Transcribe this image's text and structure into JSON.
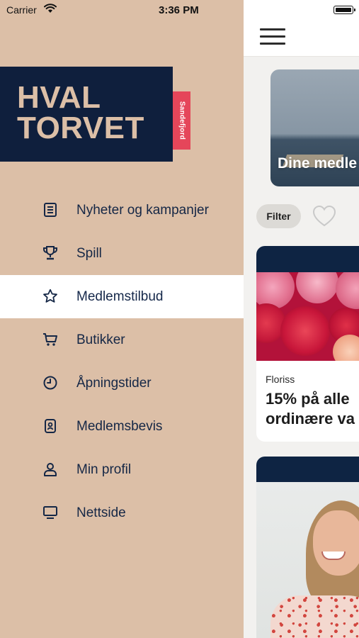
{
  "status_bar": {
    "carrier": "Carrier",
    "time": "3:36 PM"
  },
  "drawer": {
    "logo": {
      "line1": "HVAL",
      "line2": "TORVET",
      "tag": "Sandefjord"
    },
    "menu": [
      {
        "label": "Nyheter og kampanjer",
        "icon": "newspaper-icon",
        "active": false
      },
      {
        "label": "Spill",
        "icon": "trophy-icon",
        "active": false
      },
      {
        "label": "Medlemstilbud",
        "icon": "star-icon",
        "active": true
      },
      {
        "label": "Butikker",
        "icon": "cart-icon",
        "active": false
      },
      {
        "label": "Åpningstider",
        "icon": "clock-icon",
        "active": false
      },
      {
        "label": "Medlemsbevis",
        "icon": "member-card-icon",
        "active": false
      },
      {
        "label": "Min profil",
        "icon": "person-icon",
        "active": false
      },
      {
        "label": "Nettside",
        "icon": "monitor-icon",
        "active": false
      }
    ]
  },
  "content": {
    "hero_text": "Dine medle",
    "filter_label": "Filter",
    "offer_1": {
      "store": "Floriss",
      "title": "15% på alle ordinære va"
    }
  },
  "colors": {
    "drawer_bg": "#dcbfa7",
    "logo_bg": "#0f1f3d",
    "logo_text": "#dcbfa7",
    "tag_bg": "#e5465a",
    "menu_text": "#152746",
    "card_band": "#0e2443"
  }
}
